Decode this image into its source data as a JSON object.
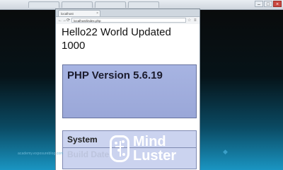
{
  "outer_browser": {
    "tabs": [
      "",
      "",
      "",
      ""
    ],
    "window_buttons": [
      "–",
      "□",
      "×"
    ]
  },
  "inner_browser": {
    "tab_title": "localhost",
    "address": "localhost/index.php",
    "nav": {
      "back": "←",
      "forward": "→",
      "refresh": "⟳"
    },
    "star_icon": "star-icon",
    "menu_icon": "menu-icon"
  },
  "page": {
    "heading": "Hello22 World Updated 1000",
    "php_version_title": "PHP Version 5.6.19",
    "table_rows": [
      {
        "label": "System"
      },
      {
        "label": "Build Date"
      }
    ]
  },
  "overlay": {
    "watermark": "academy.exposureblog.com",
    "brand_line1": "Mind",
    "brand_line2": "Luster"
  },
  "colors": {
    "background_top": "#0a0a0a",
    "background_bottom": "#1a95c2",
    "php_box": "#9aa7d8",
    "table_row": "#cbd3ef",
    "brand": "#ffffff"
  }
}
